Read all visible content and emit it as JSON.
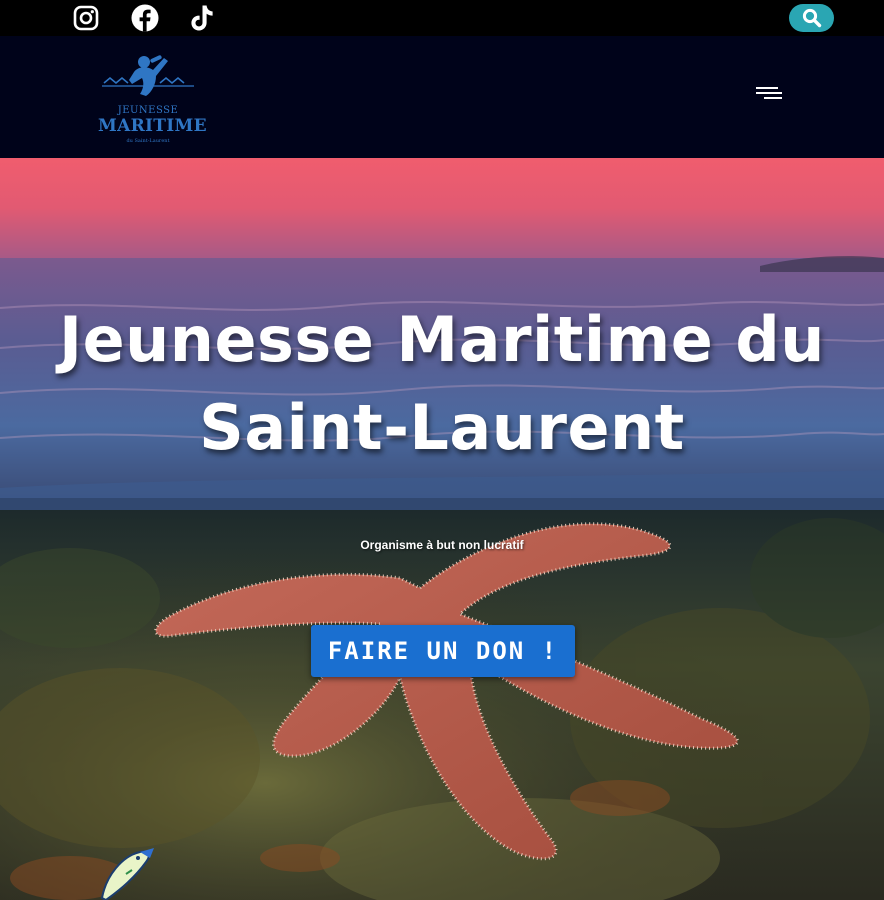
{
  "topbar": {
    "social_links": [
      {
        "icon": "instagram-icon"
      },
      {
        "icon": "facebook-icon"
      },
      {
        "icon": "tiktok-icon"
      }
    ],
    "search_icon": "search-icon",
    "search_button_color": "#2aa6b3"
  },
  "header": {
    "logo": {
      "line1": "JEUNESSE",
      "line2": "MARITIME",
      "line3": "du Saint-Laurent"
    },
    "menu_icon": "hamburger-menu-icon"
  },
  "hero": {
    "title": "Jeunesse Maritime du Saint-Laurent",
    "subtitle": "Organisme à but non lucratif",
    "cta_label": "FAIRE UN DON !",
    "cta_color": "#1a6fd0"
  }
}
